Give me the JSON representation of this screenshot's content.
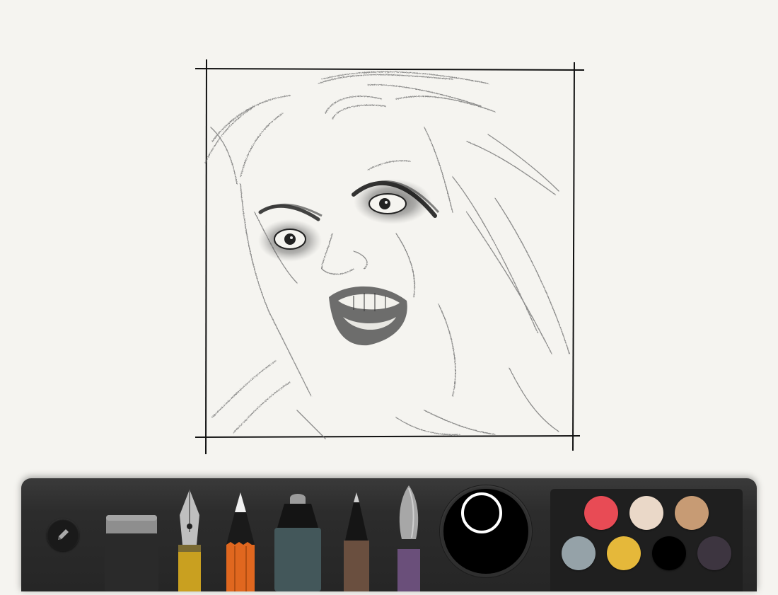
{
  "app": {
    "canvas_background": "#f5f4f0"
  },
  "toolbar": {
    "menu_icon": "pencil-icon",
    "tools": [
      {
        "name": "eraser",
        "icon": "eraser-icon",
        "color": "#2a2a2a"
      },
      {
        "name": "fountain-pen",
        "icon": "fountain-pen-icon",
        "color": "#c9a020"
      },
      {
        "name": "pencil",
        "icon": "pencil-icon",
        "color": "#e0671f",
        "selected": true
      },
      {
        "name": "marker",
        "icon": "marker-icon",
        "color": "#43575a"
      },
      {
        "name": "pen",
        "icon": "pen-icon",
        "color": "#6a4f3f"
      },
      {
        "name": "brush",
        "icon": "brush-icon",
        "color": "#6a4f7a"
      }
    ],
    "selected_color": "#000000",
    "swatches": [
      {
        "name": "red",
        "color": "#e84b55"
      },
      {
        "name": "cream",
        "color": "#ead8c8"
      },
      {
        "name": "tan",
        "color": "#c79b74"
      },
      {
        "name": "blue-grey",
        "color": "#95a2a8"
      },
      {
        "name": "yellow",
        "color": "#e5b83a"
      },
      {
        "name": "black",
        "color": "#000000"
      },
      {
        "name": "plum",
        "color": "#3d3540"
      }
    ]
  }
}
